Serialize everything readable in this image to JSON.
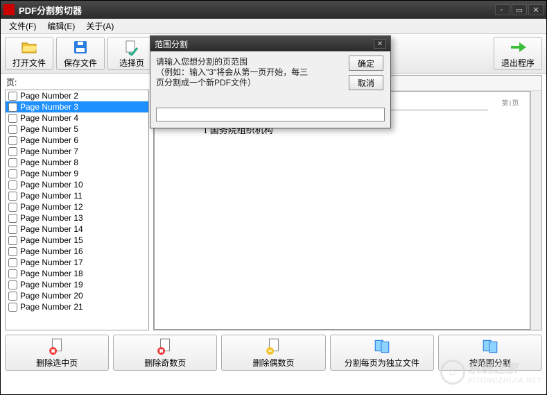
{
  "window": {
    "title": "PDF分割剪切器"
  },
  "menu": {
    "file": "文件(F)",
    "edit": "编辑(E)",
    "about": "关于(A)"
  },
  "toolbar": {
    "open": "打开文件",
    "save": "保存文件",
    "select": "选择页",
    "exit": "退出程序"
  },
  "left": {
    "label": "页:",
    "pages": [
      "Page Number 2",
      "Page Number 3",
      "Page Number 4",
      "Page Number 5",
      "Page Number 6",
      "Page Number 7",
      "Page Number 8",
      "Page Number 9",
      "Page Number 10",
      "Page Number 11",
      "Page Number 12",
      "Page Number 13",
      "Page Number 14",
      "Page Number 15",
      "Page Number 16",
      "Page Number 17",
      "Page Number 18",
      "Page Number 19",
      "Page Number 20",
      "Page Number 21"
    ],
    "selected_index": 1
  },
  "preview": {
    "page_label": "第1页",
    "content_line": "1  国务院组织机构"
  },
  "bottom": {
    "delete_selected": "删除选中页",
    "delete_odd": "删除奇数页",
    "delete_even": "删除偶数页",
    "split_each": "分割每页为独立文件",
    "split_range": "按范围分割"
  },
  "dialog": {
    "title": "范围分割",
    "prompt_1": "请输入您想分割的页范围",
    "prompt_2": "（例如：输入\"3\"将会从第一页开始，每三页分割成一个新PDF文件）",
    "ok": "确定",
    "cancel": "取消",
    "input_value": ""
  },
  "watermark": {
    "site": "XITONGZHIJIA.NET",
    "brand": "系统之家"
  }
}
